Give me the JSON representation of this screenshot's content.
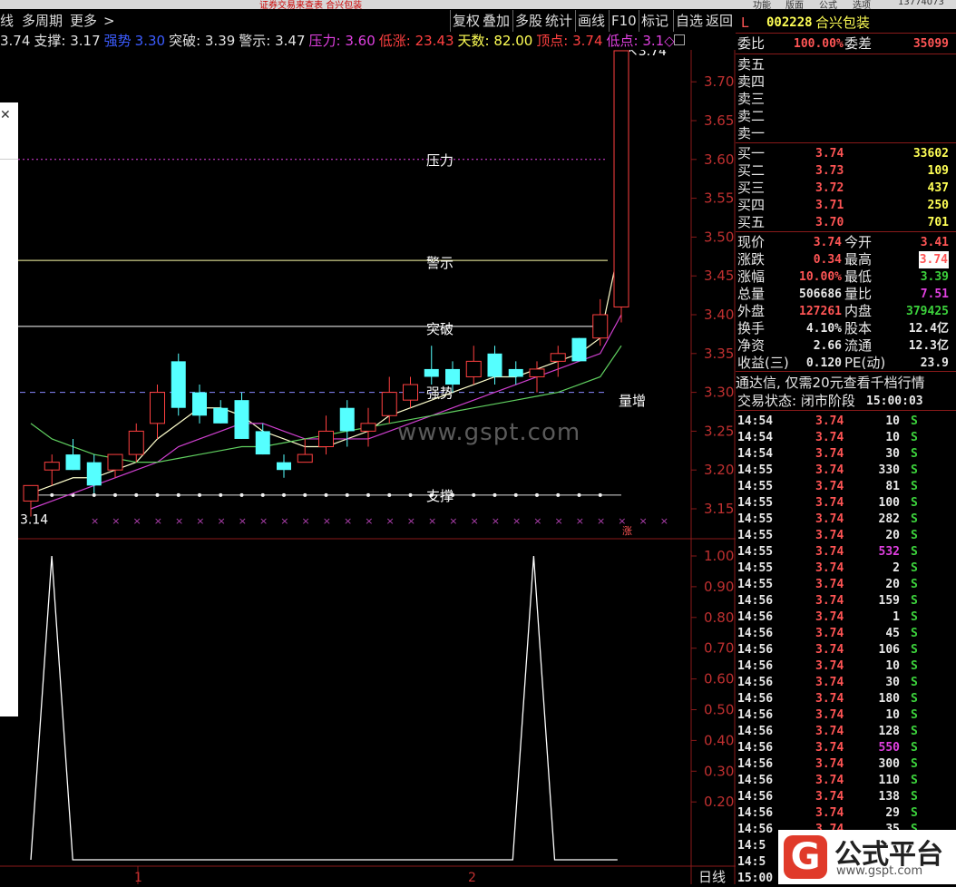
{
  "topbar": {
    "left_text": "证券交易来查表 合兴包装",
    "phone": "13774073",
    "menu": [
      "功能",
      "版面",
      "公式",
      "选项"
    ]
  },
  "menu": {
    "left": [
      "线",
      "多周期",
      "更多",
      ">"
    ],
    "right": [
      "复权",
      "叠加",
      "多股",
      "统计",
      "画线",
      "F10",
      "标记",
      "自选",
      "返回"
    ]
  },
  "info": [
    {
      "label": "3.74",
      "color": "#e0e0e0"
    },
    {
      "label": "支撑: 3.17",
      "color": "#e0e0e0"
    },
    {
      "label": "强势",
      "color": "#3c5cff"
    },
    {
      "label": "3.30",
      "color": "#3c5cff"
    },
    {
      "label": "突破: 3.39",
      "color": "#e0e0e0"
    },
    {
      "label": "警示: 3.47",
      "color": "#e0e0e0"
    },
    {
      "label": "压力: 3.60",
      "color": "#e040e0"
    },
    {
      "label": "低涨: 23.43",
      "color": "#ff4040"
    },
    {
      "label": "天数: 82.00",
      "color": "#ffff55"
    },
    {
      "label": "顶点: 3.74",
      "color": "#ff4040"
    },
    {
      "label": "低点: 3.1◇",
      "color": "#e040e0"
    }
  ],
  "stock": {
    "flag": "L",
    "code": "002228",
    "name": "合兴包装"
  },
  "weibi": {
    "label1": "委比",
    "v1": "100.00%",
    "label2": "委差",
    "v2": "35099"
  },
  "sells": [
    "卖五",
    "卖四",
    "卖三",
    "卖二",
    "卖一"
  ],
  "buys": [
    {
      "label": "买一",
      "price": "3.74",
      "vol": "33602"
    },
    {
      "label": "买二",
      "price": "3.73",
      "vol": "109"
    },
    {
      "label": "买三",
      "price": "3.72",
      "vol": "437"
    },
    {
      "label": "买四",
      "price": "3.71",
      "vol": "250"
    },
    {
      "label": "买五",
      "price": "3.70",
      "vol": "701"
    }
  ],
  "stats": [
    {
      "l1": "现价",
      "v1": "3.74",
      "c1": "red",
      "l2": "今开",
      "v2": "3.41",
      "c2": "red"
    },
    {
      "l1": "涨跌",
      "v1": "0.34",
      "c1": "red",
      "l2": "最高",
      "v2": "3.74",
      "c2": "red"
    },
    {
      "l1": "涨幅",
      "v1": "10.00%",
      "c1": "red",
      "l2": "最低",
      "v2": "3.39",
      "c2": "grn"
    },
    {
      "l1": "总量",
      "v1": "506686",
      "c1": "white",
      "l2": "量比",
      "v2": "7.51",
      "c2": "mag"
    },
    {
      "l1": "外盘",
      "v1": "127261",
      "c1": "red",
      "l2": "内盘",
      "v2": "379425",
      "c2": "grn"
    },
    {
      "l1": "换手",
      "v1": "4.10%",
      "c1": "white",
      "l2": "股本",
      "v2": "12.4亿",
      "c2": "white"
    },
    {
      "l1": "净资",
      "v1": "2.66",
      "c1": "white",
      "l2": "流通",
      "v2": "12.3亿",
      "c2": "white"
    },
    {
      "l1": "收益(三)",
      "v1": "0.120",
      "c1": "white",
      "l2": "PE(动)",
      "v2": "23.9",
      "c2": "white"
    }
  ],
  "promo": "通达信, 仅需20元查看千档行情",
  "trade_state": {
    "label": "交易状态: 闭市阶段",
    "time": "15:00:03"
  },
  "ticks": [
    {
      "t": "14:54",
      "p": "3.74",
      "v": "10",
      "vc": "white"
    },
    {
      "t": "14:54",
      "p": "3.74",
      "v": "10",
      "vc": "white"
    },
    {
      "t": "14:54",
      "p": "3.74",
      "v": "30",
      "vc": "white"
    },
    {
      "t": "14:55",
      "p": "3.74",
      "v": "330",
      "vc": "white"
    },
    {
      "t": "14:55",
      "p": "3.74",
      "v": "81",
      "vc": "white"
    },
    {
      "t": "14:55",
      "p": "3.74",
      "v": "100",
      "vc": "white"
    },
    {
      "t": "14:55",
      "p": "3.74",
      "v": "282",
      "vc": "white"
    },
    {
      "t": "14:55",
      "p": "3.74",
      "v": "20",
      "vc": "white"
    },
    {
      "t": "14:55",
      "p": "3.74",
      "v": "532",
      "vc": "mag"
    },
    {
      "t": "14:55",
      "p": "3.74",
      "v": "2",
      "vc": "white"
    },
    {
      "t": "14:55",
      "p": "3.74",
      "v": "20",
      "vc": "white"
    },
    {
      "t": "14:56",
      "p": "3.74",
      "v": "159",
      "vc": "white"
    },
    {
      "t": "14:56",
      "p": "3.74",
      "v": "1",
      "vc": "white"
    },
    {
      "t": "14:56",
      "p": "3.74",
      "v": "45",
      "vc": "white"
    },
    {
      "t": "14:56",
      "p": "3.74",
      "v": "106",
      "vc": "white"
    },
    {
      "t": "14:56",
      "p": "3.74",
      "v": "10",
      "vc": "white"
    },
    {
      "t": "14:56",
      "p": "3.74",
      "v": "30",
      "vc": "white"
    },
    {
      "t": "14:56",
      "p": "3.74",
      "v": "180",
      "vc": "white"
    },
    {
      "t": "14:56",
      "p": "3.74",
      "v": "10",
      "vc": "white"
    },
    {
      "t": "14:56",
      "p": "3.74",
      "v": "128",
      "vc": "white"
    },
    {
      "t": "14:56",
      "p": "3.74",
      "v": "550",
      "vc": "mag"
    },
    {
      "t": "14:56",
      "p": "3.74",
      "v": "300",
      "vc": "white"
    },
    {
      "t": "14:56",
      "p": "3.74",
      "v": "110",
      "vc": "white"
    },
    {
      "t": "14:56",
      "p": "3.74",
      "v": "138",
      "vc": "white"
    },
    {
      "t": "14:56",
      "p": "3.74",
      "v": "29",
      "vc": "white"
    },
    {
      "t": "14:56",
      "p": "3.74",
      "v": "35",
      "vc": "white"
    },
    {
      "t": "14:5",
      "p": "",
      "v": "",
      "vc": "white"
    },
    {
      "t": "14:5",
      "p": "",
      "v": "",
      "vc": "white"
    },
    {
      "t": "15:00",
      "p": "",
      "v": "",
      "vc": "white"
    }
  ],
  "tick_side": "S",
  "chart_labels": {
    "pressure": "压力",
    "warning": "警示",
    "breakthrough": "突破",
    "strong": "强势",
    "support": "支撑",
    "volume_up": "量增",
    "top": "3.74",
    "low": "3.14",
    "limit_up": "涨"
  },
  "bottom": {
    "page1": "1",
    "page2": "2",
    "period": "日线"
  },
  "watermark": "www.gspt.com",
  "logo": {
    "mark": "G",
    "title": "公式平台",
    "url": "www.gspt.com"
  },
  "chart_data": [
    {
      "type": "candlestick",
      "price_axis": [
        3.15,
        3.2,
        3.25,
        3.3,
        3.35,
        3.4,
        3.45,
        3.5,
        3.55,
        3.6,
        3.65,
        3.7
      ],
      "ylim": [
        3.13,
        3.75
      ],
      "lines": {
        "pressure": 3.6,
        "warning": 3.47,
        "breakthrough": 3.385,
        "strong": 3.3,
        "support": 3.17
      },
      "candles": [
        {
          "o": 3.16,
          "h": 3.18,
          "l": 3.14,
          "c": 3.18
        },
        {
          "o": 3.2,
          "h": 3.22,
          "l": 3.18,
          "c": 3.21
        },
        {
          "o": 3.22,
          "h": 3.24,
          "l": 3.2,
          "c": 3.2
        },
        {
          "o": 3.21,
          "h": 3.22,
          "l": 3.17,
          "c": 3.18
        },
        {
          "o": 3.2,
          "h": 3.22,
          "l": 3.19,
          "c": 3.22
        },
        {
          "o": 3.22,
          "h": 3.26,
          "l": 3.21,
          "c": 3.25
        },
        {
          "o": 3.26,
          "h": 3.31,
          "l": 3.24,
          "c": 3.3
        },
        {
          "o": 3.34,
          "h": 3.35,
          "l": 3.27,
          "c": 3.28
        },
        {
          "o": 3.3,
          "h": 3.31,
          "l": 3.26,
          "c": 3.27
        },
        {
          "o": 3.28,
          "h": 3.29,
          "l": 3.26,
          "c": 3.26
        },
        {
          "o": 3.29,
          "h": 3.3,
          "l": 3.24,
          "c": 3.24
        },
        {
          "o": 3.25,
          "h": 3.26,
          "l": 3.22,
          "c": 3.22
        },
        {
          "o": 3.21,
          "h": 3.22,
          "l": 3.19,
          "c": 3.2
        },
        {
          "o": 3.21,
          "h": 3.24,
          "l": 3.21,
          "c": 3.22
        },
        {
          "o": 3.23,
          "h": 3.27,
          "l": 3.22,
          "c": 3.25
        },
        {
          "o": 3.28,
          "h": 3.29,
          "l": 3.23,
          "c": 3.25
        },
        {
          "o": 3.25,
          "h": 3.28,
          "l": 3.23,
          "c": 3.26
        },
        {
          "o": 3.27,
          "h": 3.32,
          "l": 3.26,
          "c": 3.3
        },
        {
          "o": 3.29,
          "h": 3.32,
          "l": 3.28,
          "c": 3.31
        },
        {
          "o": 3.33,
          "h": 3.36,
          "l": 3.31,
          "c": 3.32
        },
        {
          "o": 3.33,
          "h": 3.34,
          "l": 3.3,
          "c": 3.31
        },
        {
          "o": 3.32,
          "h": 3.36,
          "l": 3.31,
          "c": 3.34
        },
        {
          "o": 3.35,
          "h": 3.36,
          "l": 3.31,
          "c": 3.32
        },
        {
          "o": 3.33,
          "h": 3.34,
          "l": 3.31,
          "c": 3.32
        },
        {
          "o": 3.32,
          "h": 3.34,
          "l": 3.3,
          "c": 3.33
        },
        {
          "o": 3.34,
          "h": 3.36,
          "l": 3.32,
          "c": 3.35
        },
        {
          "o": 3.37,
          "h": 3.37,
          "l": 3.34,
          "c": 3.34
        },
        {
          "o": 3.37,
          "h": 3.42,
          "l": 3.36,
          "c": 3.4
        },
        {
          "o": 3.41,
          "h": 3.74,
          "l": 3.39,
          "c": 3.74
        }
      ],
      "ma": {
        "ma_white": [
          3.17,
          3.18,
          3.19,
          3.19,
          3.2,
          3.21,
          3.24,
          3.26,
          3.28,
          3.28,
          3.27,
          3.25,
          3.24,
          3.23,
          3.23,
          3.24,
          3.25,
          3.27,
          3.28,
          3.29,
          3.3,
          3.31,
          3.32,
          3.32,
          3.33,
          3.34,
          3.35,
          3.37,
          3.5
        ],
        "ma_magenta": [
          3.15,
          3.16,
          3.17,
          3.18,
          3.19,
          3.2,
          3.21,
          3.23,
          3.24,
          3.25,
          3.26,
          3.26,
          3.25,
          3.24,
          3.24,
          3.24,
          3.24,
          3.25,
          3.26,
          3.27,
          3.28,
          3.29,
          3.3,
          3.31,
          3.32,
          3.33,
          3.34,
          3.35,
          3.4
        ],
        "ma_green": [
          3.26,
          3.24,
          3.23,
          3.22,
          3.215,
          3.21,
          3.21,
          3.215,
          3.22,
          3.225,
          3.23,
          3.23,
          3.235,
          3.24,
          3.245,
          3.25,
          3.255,
          3.26,
          3.265,
          3.27,
          3.275,
          3.28,
          3.285,
          3.29,
          3.295,
          3.3,
          3.31,
          3.32,
          3.36
        ]
      }
    },
    {
      "type": "line",
      "ylim": [
        0,
        1.05
      ],
      "y_axis": [
        "1.00",
        "0.90",
        "0.80",
        "0.70",
        "0.60",
        "0.50",
        "0.40",
        "0.30",
        "0.20"
      ],
      "values": [
        0,
        1,
        0,
        0,
        0,
        0,
        0,
        0,
        0,
        0,
        0,
        0,
        0,
        0,
        0,
        0,
        0,
        0,
        0,
        0,
        0,
        0,
        0,
        0,
        1,
        0,
        0,
        0,
        0
      ]
    }
  ]
}
